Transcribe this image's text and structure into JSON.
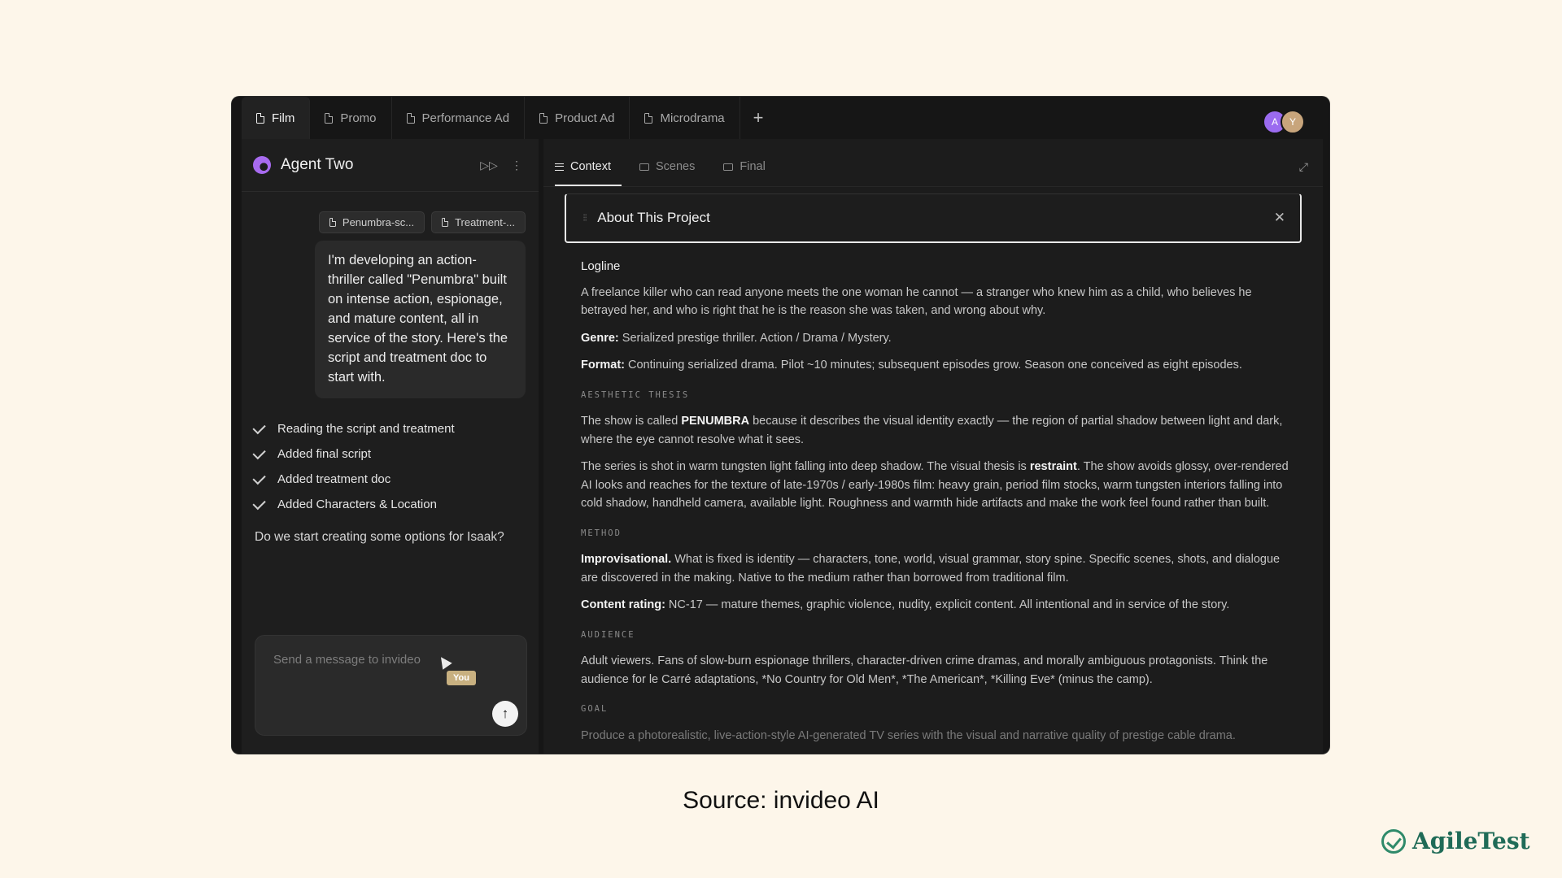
{
  "tabs": [
    {
      "label": "Film",
      "active": true
    },
    {
      "label": "Promo"
    },
    {
      "label": "Performance Ad"
    },
    {
      "label": "Product Ad"
    },
    {
      "label": "Microdrama"
    }
  ],
  "add_tab_label": "+",
  "avatars": [
    "A",
    "Y"
  ],
  "agent": {
    "name": "Agent Two",
    "attachments": [
      "Penumbra-sc...",
      "Treatment-..."
    ],
    "user_message": "I'm developing an action-thriller called \"Penumbra\" built on intense action, espionage, and mature content, all in service of the story. Here's the script and treatment doc to start with.",
    "steps": [
      "Reading the script and treatment",
      "Added final script",
      "Added treatment doc",
      "Added Characters & Location"
    ],
    "question": "Do we start creating some options for Isaak?"
  },
  "composer": {
    "placeholder": "Send a message to invideo",
    "cursor_badge": "You",
    "send_icon": "arrow-up-icon"
  },
  "subtabs": [
    {
      "label": "Context",
      "active": true,
      "icon": "lines-icon"
    },
    {
      "label": "Scenes",
      "icon": "folder-icon"
    },
    {
      "label": "Final",
      "icon": "folder-icon"
    }
  ],
  "card": {
    "title": "About This Project",
    "logline_heading": "Logline",
    "logline": "A freelance killer who can read anyone meets the one woman he cannot — a stranger who knew him as a child, who believes he betrayed her, and who is right that he is the reason she was taken, and wrong about why.",
    "genre_label": "Genre:",
    "genre": " Serialized prestige thriller. Action / Drama / Mystery.",
    "format_label": "Format:",
    "format": " Continuing serialized drama. Pilot ~10 minutes; subsequent episodes grow. Season one conceived as eight episodes.",
    "aesthetic_label": "AESTHETIC THESIS",
    "aesthetic_p1_a": "The show is called ",
    "aesthetic_p1_b": "PENUMBRA",
    "aesthetic_p1_c": " because it describes the visual identity exactly — the region of partial shadow between light and dark, where the eye cannot resolve what it sees.",
    "aesthetic_p2_a": "The series is shot in warm tungsten light falling into deep shadow. The visual thesis is ",
    "aesthetic_p2_b": "restraint",
    "aesthetic_p2_c": ". The show avoids glossy, over-rendered AI looks and reaches for the texture of late-1970s / early-1980s film: heavy grain, period film stocks, warm tungsten interiors falling into cold shadow, handheld camera, available light. Roughness and warmth hide artifacts and make the work feel found rather than built.",
    "method_label": "METHOD",
    "method_b": "Improvisational.",
    "method_text": " What is fixed is identity — characters, tone, world, visual grammar, story spine. Specific scenes, shots, and dialogue are discovered in the making. Native to the medium rather than borrowed from traditional film.",
    "rating_label": "Content rating:",
    "rating": " NC-17 — mature themes, graphic violence, nudity, explicit content. All intentional and in service of the story.",
    "audience_label": "AUDIENCE",
    "audience": "Adult viewers. Fans of slow-burn espionage thrillers, character-driven crime dramas, and morally ambiguous protagonists. Think the audience for le Carré adaptations, *No Country for Old Men*, *The American*, *Killing Eve* (minus the camp).",
    "goal_label": "GOAL",
    "goal": "Produce a photorealistic, live-action-style AI-generated TV series with the visual and narrative quality of prestige cable drama."
  },
  "caption": "Source: invideo AI",
  "brand": "AgileTest",
  "colors": {
    "page_bg": "#fdf6ea",
    "window_bg": "#161616",
    "accent_purple": "#9b6bf0",
    "brand_green": "#1f6b57"
  }
}
